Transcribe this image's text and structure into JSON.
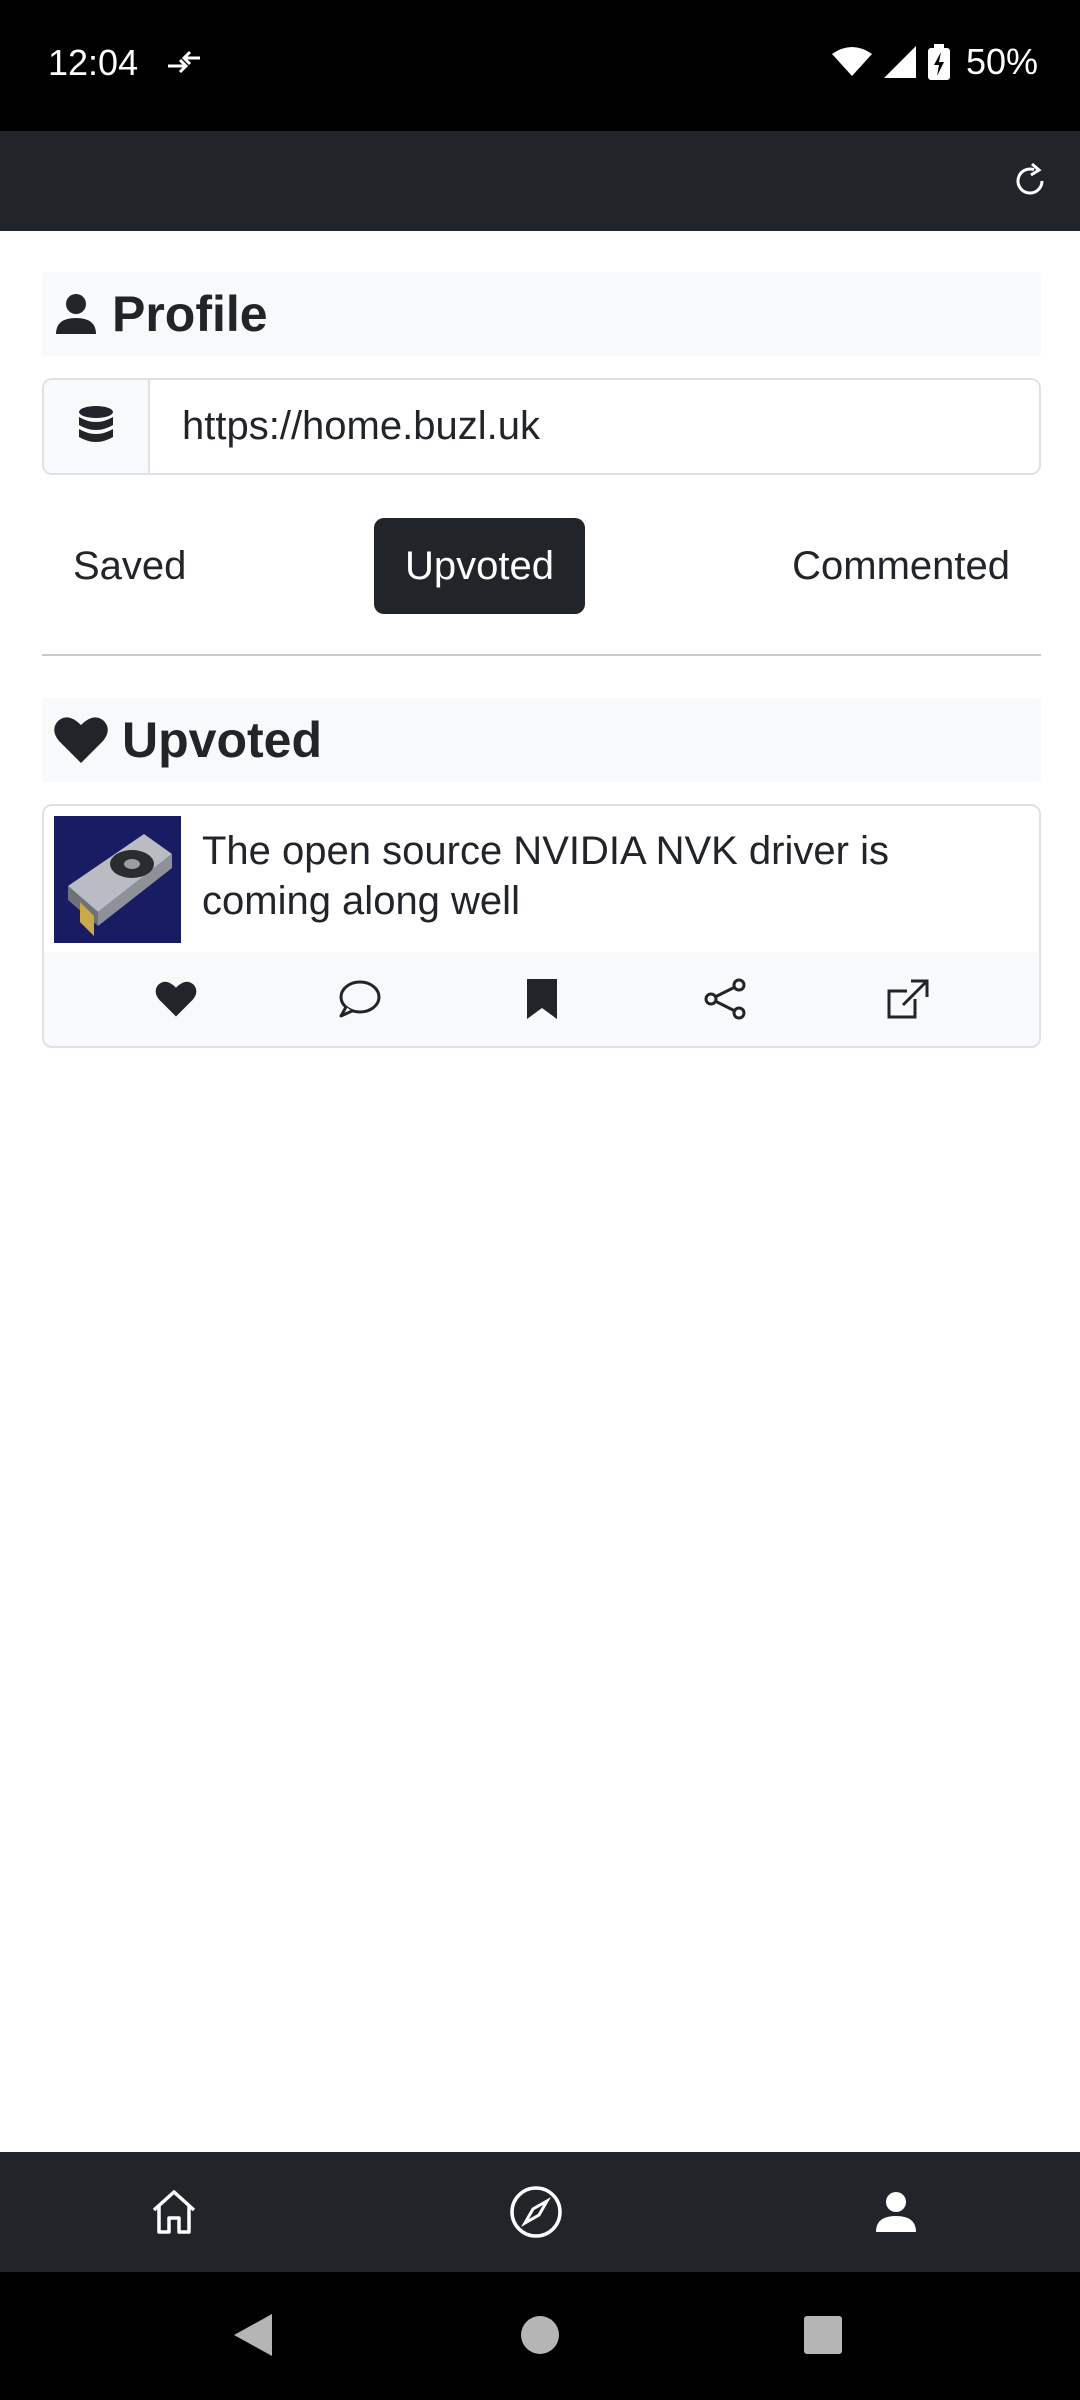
{
  "status_bar": {
    "time": "12:04",
    "battery": "50%"
  },
  "profile": {
    "title": "Profile",
    "instance_url": "https://home.buzl.uk"
  },
  "tabs": [
    {
      "label": "Saved",
      "active": false
    },
    {
      "label": "Upvoted",
      "active": true
    },
    {
      "label": "Commented",
      "active": false
    }
  ],
  "list_section": {
    "title": "Upvoted"
  },
  "posts": [
    {
      "title": "The open source NVIDIA NVK driver is coming along well"
    }
  ],
  "colors": {
    "dark": "#212529",
    "light_bg": "#f8f9fa",
    "border": "#dee2e6"
  }
}
